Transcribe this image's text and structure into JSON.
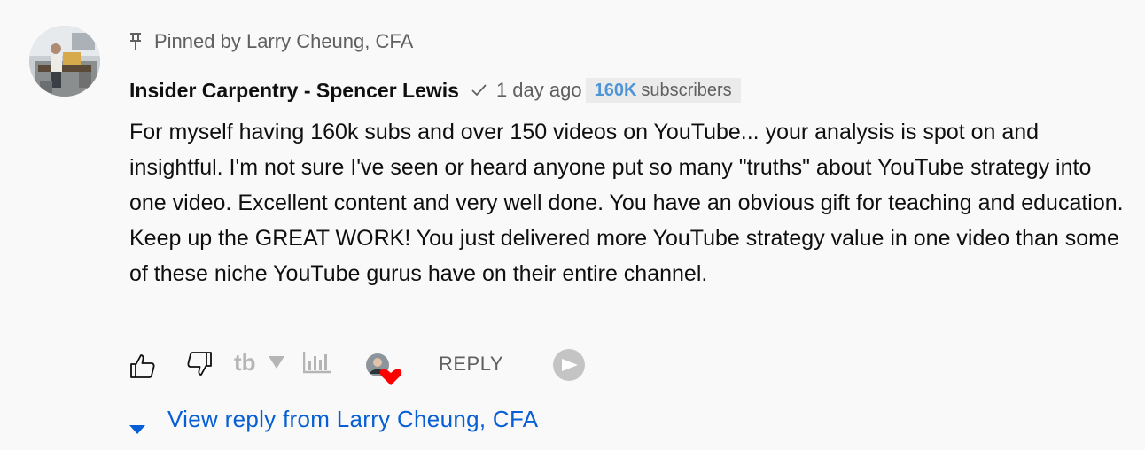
{
  "pinned": {
    "label": "Pinned by Larry Cheung, CFA"
  },
  "comment": {
    "author": "Insider Carpentry - Spencer Lewis",
    "time": "1 day ago",
    "subscriber_count": "160K",
    "subscriber_label": "subscribers",
    "text": "For myself having 160k subs and over 150 videos on YouTube... your analysis is spot on and insightful. I'm not sure I've seen or heard anyone put so many \"truths\" about YouTube strategy into one video. Excellent content and very well done. You have an obvious gift for teaching and education. Keep up the GREAT WORK! You just delivered more YouTube strategy value in one video than some of these niche YouTube gurus have on their entire channel."
  },
  "actions": {
    "reply_label": "REPLY"
  },
  "replies": {
    "view_label": "View reply from Larry Cheung, CFA"
  },
  "colors": {
    "link_blue": "#065fd4",
    "subs_blue": "#4f95d6",
    "heart_red": "#ff0000",
    "muted_gray": "#606060"
  },
  "icons": [
    "pin-icon",
    "verified-check-icon",
    "like-icon",
    "dislike-icon",
    "tubebuddy-icon",
    "dropdown-triangle-icon",
    "analytics-icon",
    "creator-heart-icon",
    "vidiq-icon",
    "caret-down-icon"
  ]
}
